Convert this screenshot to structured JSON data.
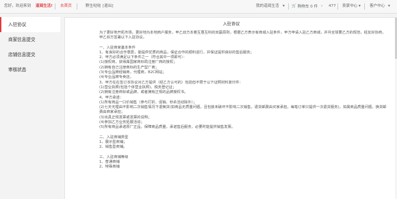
{
  "topbar": {
    "greeting": "您好，欢迎来到",
    "site_name": "道闻生活!",
    "home_link": "去首页",
    "user": "野生哒哒",
    "logout": "[退出]",
    "my_life": "我的道闻生活",
    "cart": "购物车 0 件",
    "count": "477",
    "seller_center": "卖家中心",
    "customer_center": "客户中心"
  },
  "sidebar": {
    "items": [
      {
        "label": "入驻协议"
      },
      {
        "label": "商家信息提交"
      },
      {
        "label": "店铺信息提交"
      },
      {
        "label": "审核状态"
      }
    ]
  },
  "doc": {
    "title": "入驻协议",
    "paragraphs": [
      "为了更好地开拓市场，更好地为本地商户服务，甲乙双方本着互惠互利的双赢原则，根据乙方表示有商城入驻条件，甲方申请入驻乙方商城，并共全球要乙方的规范，经友好协商，甲乙双方签署以下入驻协议。",
      "",
      "一、入驻商家基本条件",
      "1、有良好的合作意愿，能提供优质的商品，保证合作的顺利进行，并保证提供良好的售后服务；",
      "2、甲方必须满足以下条件之一（符合其中一项即可）：",
      "(1)授权商，获得属国家商标局注册厂商的授权；",
      "(2)拥有自己注册商标的生产型厂商；",
      "(3)专业品牌经销商，代理商，B2C网站；",
      "(4)专业品牌专卖店。",
      "3、甲方在在签订本协议对乙方提供（经乙方认可的）包括但不限于以下证照材料复印件：",
      "(1)营业执照(包括个体营业执照)、税务登记证；",
      "(2)拥有注册商标或品牌，或者拥有正规的品牌授权书。",
      "4、甲方承诺：",
      "(1)所有商品一口价销售（参与打折、促销、秒杀活动除外）；",
      "(2)七天无理由不影响二次销售情况下退换货(如商品无质量问题，且包装未破坏不影响二次销售，退货邮费由买家承担，每笔订单只提供一次退货服务)，如属商品质量问题，换货邮费由商家承担；",
      "(3)出具正规发票或发票的说明；",
      "(4)参加乙方业务拓展活动；",
      "(5)所有商品承诺原厂正品，保障商品质量，承诺售后服务，必要时能提供销售发票。",
      "",
      "二、入驻商铺类型",
      "1、展示型商铺；",
      "2、销售型商铺。",
      "",
      "三、入驻商铺等级",
      "1、普通商铺",
      "2、特殊商铺"
    ]
  },
  "colors": {
    "accent": "#e4393c",
    "page_bg": "#f3f3f3"
  }
}
